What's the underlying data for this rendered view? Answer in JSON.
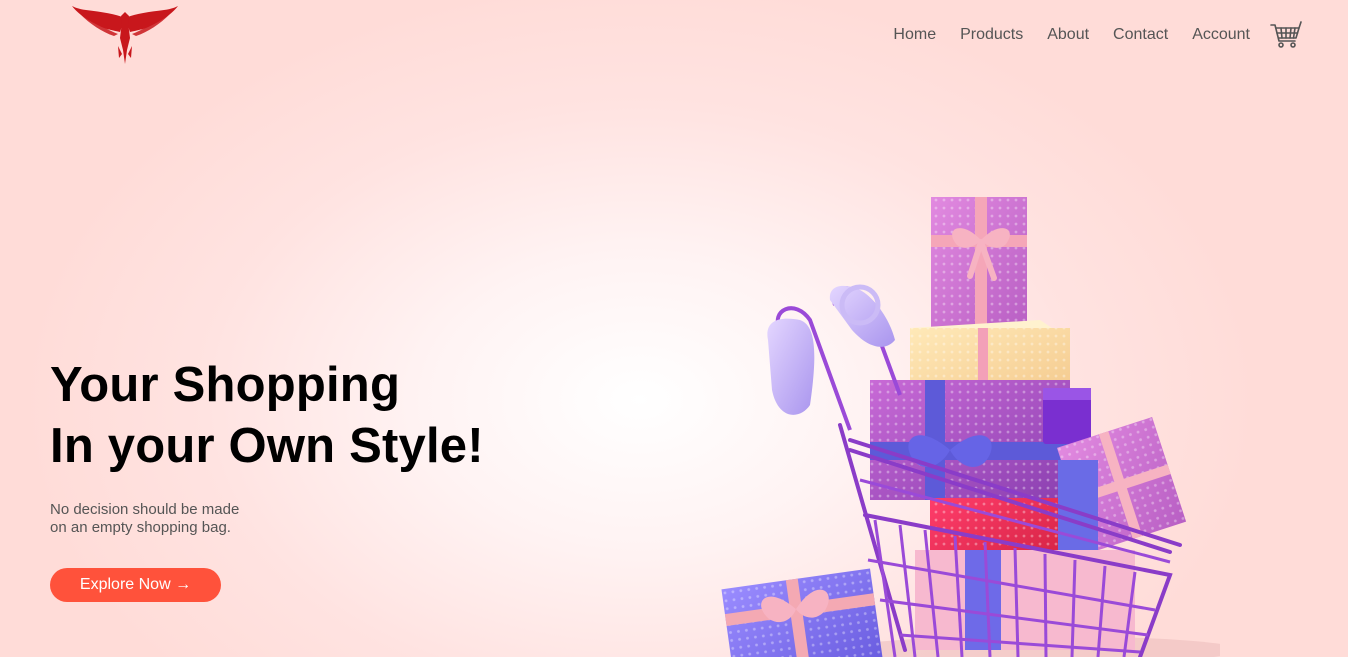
{
  "brand": {
    "logo_icon": "eagle-logo",
    "color": "#c8171c"
  },
  "nav": {
    "links": [
      "Home",
      "Products",
      "About",
      "Contact",
      "Account"
    ],
    "cart_icon": "shopping-cart-icon"
  },
  "hero": {
    "title_line1": "Your Shopping",
    "title_line2": "In your Own Style!",
    "subtitle_line1": "No decision should be made",
    "subtitle_line2": "on an empty shopping bag.",
    "cta_label": "Explore Now →",
    "cta_color": "#ff523b",
    "image_icon": "shopping-cart-with-gifts-illustration"
  }
}
